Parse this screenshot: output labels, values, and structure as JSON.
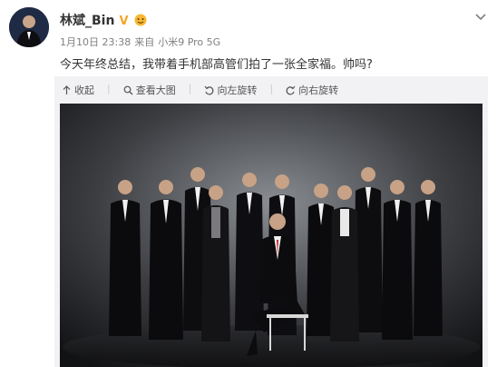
{
  "post": {
    "author": "林斌_Bin",
    "verified_mark": "V",
    "date": "1月10日 23:38",
    "source_prefix": "来自",
    "device": "小米9 Pro 5G",
    "text": "今天年终总结，我带着手机部高管们拍了一张全家福。帅吗?"
  },
  "toolbar": {
    "collapse": "收起",
    "view_large": "查看大图",
    "rotate_left": "向左旋转",
    "rotate_right": "向右旋转"
  },
  "colors": {
    "accent": "#eb7350",
    "verified": "#f5a623",
    "meta": "#808080"
  },
  "icons": [
    "collapse-icon",
    "magnifier-icon",
    "rotate-left-icon",
    "rotate-right-icon",
    "chevron-down-icon"
  ]
}
